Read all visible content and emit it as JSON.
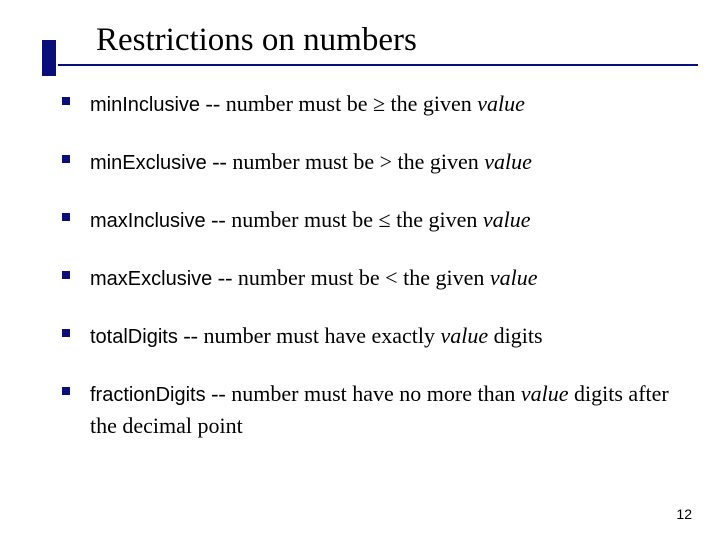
{
  "title": "Restrictions on numbers",
  "items": [
    {
      "term": "minInclusive",
      "pre": " -- number must be ≥ the given ",
      "val": "value",
      "post": ""
    },
    {
      "term": "minExclusive",
      "pre": " -- number must be > the given ",
      "val": "value",
      "post": ""
    },
    {
      "term": "maxInclusive",
      "pre": " -- number must be ≤ the given ",
      "val": "value",
      "post": ""
    },
    {
      "term": "maxExclusive",
      "pre": " -- number must be < the given ",
      "val": "value",
      "post": ""
    },
    {
      "term": "totalDigits",
      "pre": " -- number must have exactly ",
      "val": "value",
      "post": " digits"
    },
    {
      "term": "fractionDigits",
      "pre": " -- number must have no more than ",
      "val": "value",
      "post": " digits after the decimal point"
    }
  ],
  "page_number": "12"
}
